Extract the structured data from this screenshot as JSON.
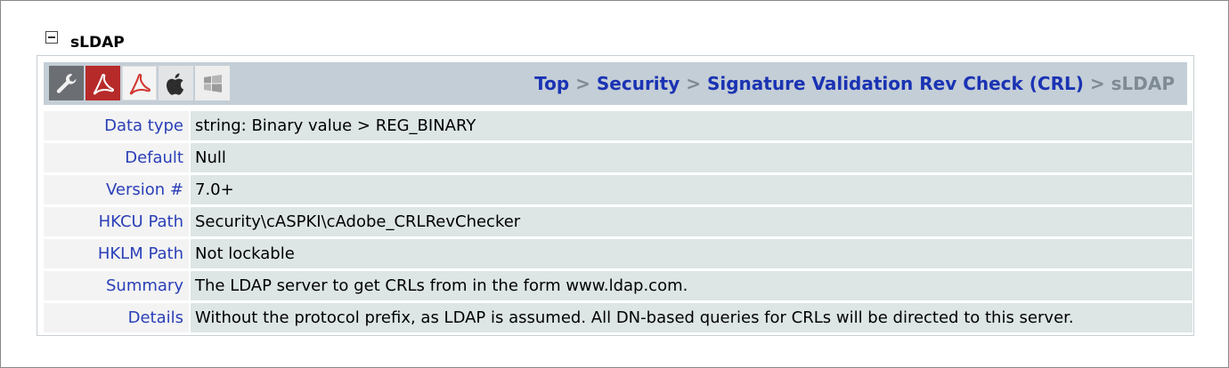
{
  "section": {
    "title": "sLDAP",
    "collapse_icon": "collapse-minus-icon"
  },
  "toolbar": {
    "icons": [
      "wrench-icon",
      "acrobat-pdf-icon",
      "reader-pdf-icon",
      "apple-icon",
      "windows-icon"
    ]
  },
  "breadcrumb": {
    "items": [
      "Top",
      "Security",
      "Signature Validation Rev Check (CRL)"
    ],
    "separator": ">",
    "current": "sLDAP"
  },
  "rows": [
    {
      "label": "Data type",
      "value": "string: Binary value > REG_BINARY"
    },
    {
      "label": "Default",
      "value": "Null"
    },
    {
      "label": "Version #",
      "value": "7.0+"
    },
    {
      "label": "HKCU Path",
      "value": "Security\\cASPKI\\cAdobe_CRLRevChecker"
    },
    {
      "label": "HKLM Path",
      "value": "Not lockable"
    },
    {
      "label": "Summary",
      "value": "The LDAP server to get CRLs from in the form www.ldap.com."
    },
    {
      "label": "Details",
      "value": "Without the protocol prefix, as LDAP is assumed. All DN-based queries for CRLs will be directed to this server."
    }
  ],
  "colors": {
    "label_text": "#2a3fb8",
    "link": "#1a33b3",
    "toolbar_bg": "#c4ced6",
    "value_bg": "#dde5e5",
    "label_bg": "#f3f3f3"
  }
}
